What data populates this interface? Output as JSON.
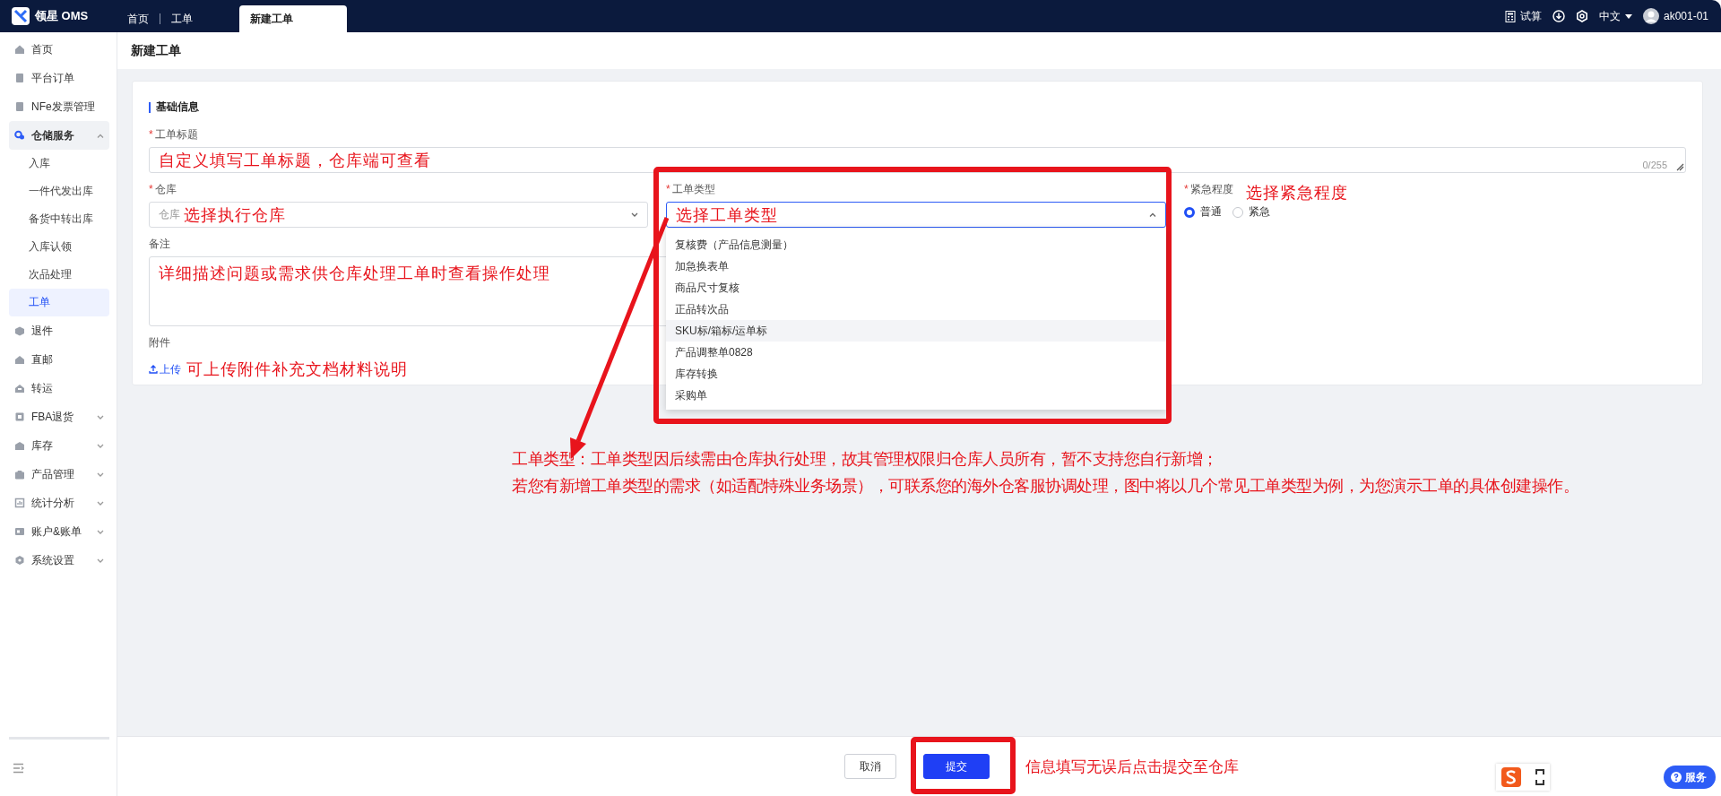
{
  "topbar": {
    "logo": "领星 OMS",
    "tabs": [
      {
        "label": "首页",
        "selected": false
      },
      {
        "label": "工单",
        "selected": false
      },
      {
        "label": "新建工单",
        "selected": true
      }
    ],
    "trial": "试算",
    "language": "中文",
    "user": "ak001-01"
  },
  "sidebar": {
    "items": [
      {
        "label": "首页",
        "selected": false
      },
      {
        "label": "平台订单",
        "selected": false
      },
      {
        "label": "NFe发票管理",
        "selected": false
      },
      {
        "label": "仓储服务",
        "selected": false,
        "expanded": true,
        "children": [
          {
            "label": "入库",
            "selected": false
          },
          {
            "label": "一件代发出库",
            "selected": false
          },
          {
            "label": "备货中转出库",
            "selected": false
          },
          {
            "label": "入库认领",
            "selected": false
          },
          {
            "label": "次品处理",
            "selected": false
          },
          {
            "label": "工单",
            "selected": true
          }
        ]
      },
      {
        "label": "退件",
        "selected": false
      },
      {
        "label": "直邮",
        "selected": false
      },
      {
        "label": "转运",
        "selected": false
      },
      {
        "label": "FBA退货",
        "selected": false,
        "expanded": false
      },
      {
        "label": "库存",
        "selected": false,
        "expanded": false
      },
      {
        "label": "产品管理",
        "selected": false,
        "expanded": false
      },
      {
        "label": "统计分析",
        "selected": false,
        "expanded": false
      },
      {
        "label": "账户&账单",
        "selected": false,
        "expanded": false
      },
      {
        "label": "系统设置",
        "selected": false,
        "expanded": false
      }
    ]
  },
  "page_title": "新建工单",
  "form": {
    "section_title": "基础信息",
    "fields": [
      {
        "kind": "text",
        "label": "工单标题",
        "required_mark": "*",
        "counter": "0/255",
        "annotation": "自定义填写工单标题，仓库端可查看"
      },
      {
        "kind": "select",
        "label": "仓库",
        "required_mark": "*",
        "open": false,
        "prefix": "仓库",
        "annotation": "选择执行仓库"
      },
      {
        "kind": "select",
        "label": "工单类型",
        "required_mark": "*",
        "open": true,
        "annotation": "选择工单类型",
        "options": [
          {
            "label": "复核费（产品信息测量）",
            "hovered": false
          },
          {
            "label": "加急换表单",
            "hovered": false
          },
          {
            "label": "商品尺寸复核",
            "hovered": false
          },
          {
            "label": "正品转次品",
            "hovered": false
          },
          {
            "label": "SKU标/箱标/运单标",
            "hovered": true
          },
          {
            "label": "产品调整单0828",
            "hovered": false
          },
          {
            "label": "库存转换",
            "hovered": false
          },
          {
            "label": "采购单",
            "hovered": false
          }
        ]
      },
      {
        "kind": "radio",
        "label": "紧急程度",
        "required_mark": "*",
        "annotation": "选择紧急程度",
        "options": [
          {
            "label": "普通",
            "selected": true
          },
          {
            "label": "紧急",
            "selected": false
          }
        ]
      },
      {
        "kind": "textarea",
        "label": "备注",
        "annotation": "详细描述问题或需求供仓库处理工单时查看操作处理"
      },
      {
        "kind": "upload",
        "label": "附件",
        "button": "上传",
        "annotation": "可上传附件补充文档材料说明"
      }
    ]
  },
  "note": {
    "lines": [
      "工单类型：工单类型因后续需由仓库执行处理，故其管理权限归仓库人员所有，暂不支持您自行新增；",
      "若您有新增工单类型的需求（如适配特殊业务场景），可联系您的海外仓客服协调处理，图中将以几个常见工单类型为例，为您演示工单的具体创建操作。"
    ]
  },
  "bottom_bar": {
    "buttons": [
      {
        "label": "取消",
        "kind": "secondary"
      },
      {
        "label": "提交",
        "kind": "primary"
      }
    ],
    "annotation": "信息填写无误后点击提交至仓库"
  },
  "service_button": "服务"
}
